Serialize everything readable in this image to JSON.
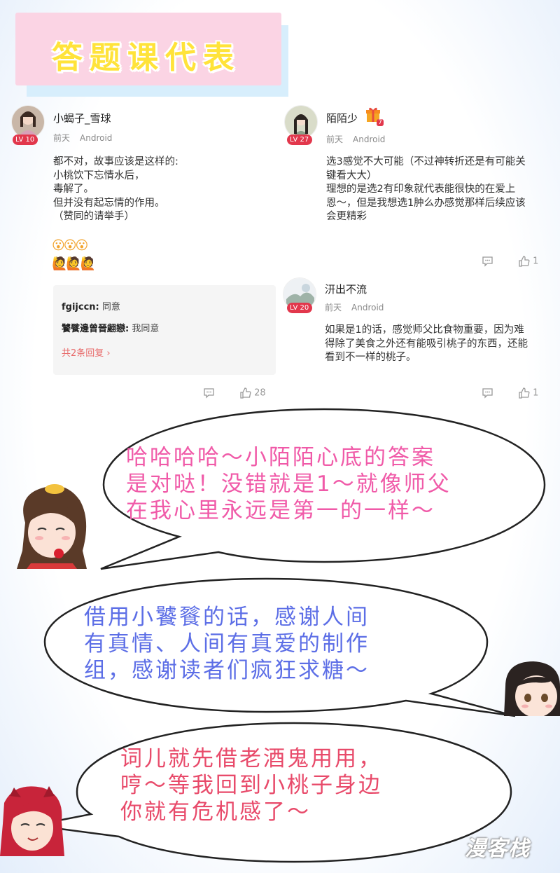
{
  "title": "答题课代表",
  "comments": [
    {
      "username": "小蝎子_雪球",
      "level": "LV 10",
      "time": "前天",
      "platform": "Android",
      "text": "都不对，故事应该是这样的:\n小桃饮下忘情水后，\n毒解了。\n但并没有起忘情的作用。\n（赞同的请举手）",
      "emoji_row1": "😮😮😮",
      "emoji_row2": "🙋🙋🙋",
      "replies": [
        {
          "user": "fgijccn:",
          "text": " 同意"
        },
        {
          "user": "饕餮邊曾晉翽戀:",
          "text": " 我同意"
        }
      ],
      "more_replies": "共2条回复",
      "likes": "28"
    },
    {
      "username": "陌陌少",
      "level": "LV 27",
      "gift_badge": "7",
      "time": "前天",
      "platform": "Android",
      "text": "选3感觉不大可能（不过神转折还是有可能关\n键看大大）\n理想的是选2有印象就代表能很快的在爱上\n恩～，但是我想选1肿么办感觉那样后续应该\n会更精彩",
      "likes": "1"
    },
    {
      "username": "汧出不流",
      "level": "LV 20",
      "time": "前天",
      "platform": "Android",
      "text": "如果是1的话，感觉师父比食物重要，因为难\n得除了美食之外还有能吸引桃子的东西，还能\n看到不一样的桃子。",
      "likes": "1"
    }
  ],
  "bubbles": [
    {
      "text": "哈哈哈哈～小陌陌心底的答案\n是对哒！没错就是1～就像师父\n在我心里永远是第一的一样～",
      "color": "#f05aa8"
    },
    {
      "text": "借用小饕餮的话，感谢人间\n有真情、人间有真爱的制作\n组，感谢读者们疯狂求糖～",
      "color": "#5c6ee6"
    },
    {
      "text": "词儿就先借老酒鬼用用，\n哼～等我回到小桃子身边\n你就有危机感了～",
      "color": "#e84a6a"
    }
  ],
  "watermark": "漫客栈",
  "colors": {
    "title_bg": "#fbd4e4",
    "title_text": "#ffe33a",
    "level_badge": "#e2374c",
    "more_link": "#e86a6a"
  },
  "icons": [
    "comment-icon",
    "thumbs-up-icon",
    "gift-icon"
  ]
}
